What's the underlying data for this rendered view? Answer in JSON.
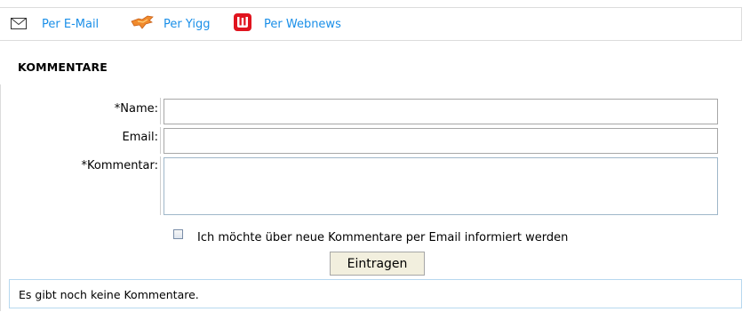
{
  "share": {
    "items": [
      {
        "label": "Per E-Mail",
        "icon": "envelope-icon"
      },
      {
        "label": "Per Yigg",
        "icon": "yigg-icon"
      },
      {
        "label": "Per Webnews",
        "icon": "webnews-icon"
      }
    ],
    "link_color": "#1a8fe8"
  },
  "comments": {
    "section_title": "KOMMENTARE",
    "fields": {
      "name_label": "*Name:",
      "name_value": "",
      "email_label": "Email:",
      "email_value": "",
      "comment_label": "*Kommentar:",
      "comment_value": ""
    },
    "notify_checkbox": {
      "label": "Ich möchte über neue Kommentare per Email informiert werden",
      "checked": false
    },
    "submit_label": "Eintragen",
    "empty_message": "Es gibt noch keine Kommentare."
  }
}
